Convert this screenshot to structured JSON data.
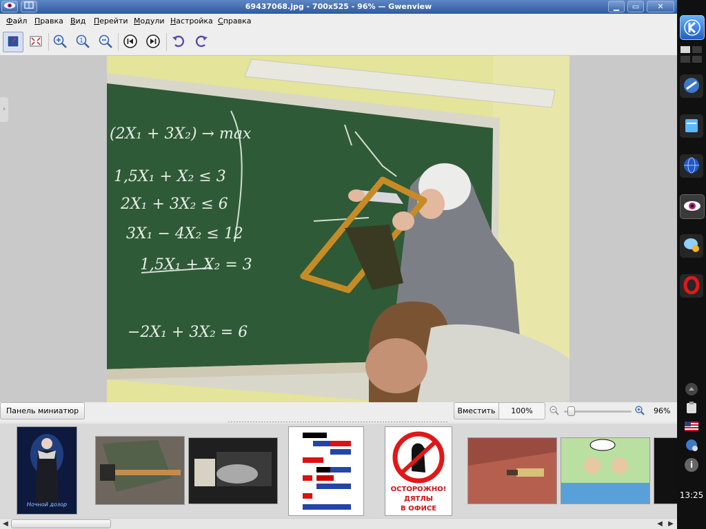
{
  "window": {
    "title": "69437068.jpg - 700x525 - 96% — Gwenview",
    "minimize_glyph": "▁",
    "maximize_glyph": "▭",
    "close_glyph": "✕"
  },
  "menu": [
    {
      "label": "Файл"
    },
    {
      "label": "Правка"
    },
    {
      "label": "Вид"
    },
    {
      "label": "Перейти"
    },
    {
      "label": "Модули"
    },
    {
      "label": "Настройка"
    },
    {
      "label": "Справка"
    }
  ],
  "toolbar": {
    "icons": [
      "browse-icon",
      "fullscreen-icon",
      "zoom-in-icon",
      "zoom-original-icon",
      "zoom-out-icon",
      "go-first-icon",
      "go-last-icon",
      "rotate-left-icon",
      "rotate-right-icon"
    ]
  },
  "photo": {
    "board_formulas": [
      "(2X₁ + 3X₂) → max",
      "1,5X₁ + X₂ ≤ 3",
      "2X₁ + 3X₂ ≤ 6",
      "3X₁ − 4X₂ ≤ 12",
      "1,5X₁ + X₂ = 3",
      "−2X₁ + 3X₂ = 6"
    ]
  },
  "status": {
    "thumbnail_button": "Панель миниатюр",
    "fit_button": "Вместить",
    "zoom_100_button": "100%",
    "zoom_value": "96%",
    "zoom_fraction": 0.06
  },
  "thumbnails": {
    "poster_lines": [
      "Ночной дозор"
    ],
    "warning_sign": [
      "ОСТОРОЖНО!",
      "ДЯТЛЫ",
      "В ОФИСЕ"
    ]
  },
  "panel": {
    "clock": "13:25",
    "flag_label": "US"
  },
  "colors": {
    "titlebar": "#3c66a8",
    "chalkboard": "#2f5a37",
    "accent": "#3d6fb5"
  }
}
